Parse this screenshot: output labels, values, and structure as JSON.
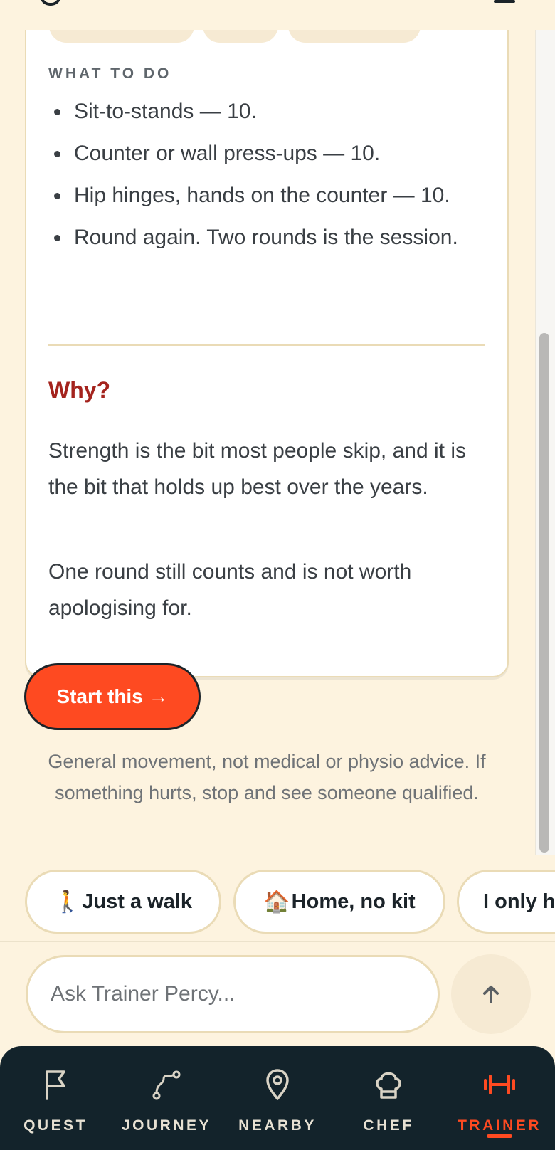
{
  "plan": {
    "section_label": "WHAT TO DO",
    "steps": [
      "Sit-to-stands — 10.",
      "Counter or wall press-ups — 10.",
      "Hip hinges, hands on the counter — 10.",
      "Round again. Two rounds is the session."
    ],
    "why_title": "Why?",
    "why_p1": "Strength is the bit most people skip, and it is the bit that holds up best over the years.",
    "why_p2": "One round still counts and is not worth apologising for.",
    "start_label": "Start this →"
  },
  "disclaimer": "General movement, not medical or physio advice. If something hurts, stop and see someone qualified.",
  "chips": [
    {
      "emoji": "🚶",
      "label": "Just a walk"
    },
    {
      "emoji": "🏠",
      "label": "Home, no kit"
    },
    {
      "emoji": "",
      "label": "I only h"
    }
  ],
  "composer": {
    "placeholder": "Ask Trainer Percy..."
  },
  "nav": {
    "items": [
      {
        "label": "QUEST",
        "icon": "flag-icon"
      },
      {
        "label": "JOURNEY",
        "icon": "route-icon"
      },
      {
        "label": "NEARBY",
        "icon": "map-pin-icon"
      },
      {
        "label": "CHEF",
        "icon": "chef-hat-icon"
      },
      {
        "label": "TRAINER",
        "icon": "dumbbell-icon"
      }
    ],
    "active": "TRAINER"
  },
  "colors": {
    "background": "#fdf3df",
    "accent": "#fe4a21",
    "why_title": "#a4231d",
    "nav_bg": "#13232b",
    "card_border": "#eadbb6"
  }
}
